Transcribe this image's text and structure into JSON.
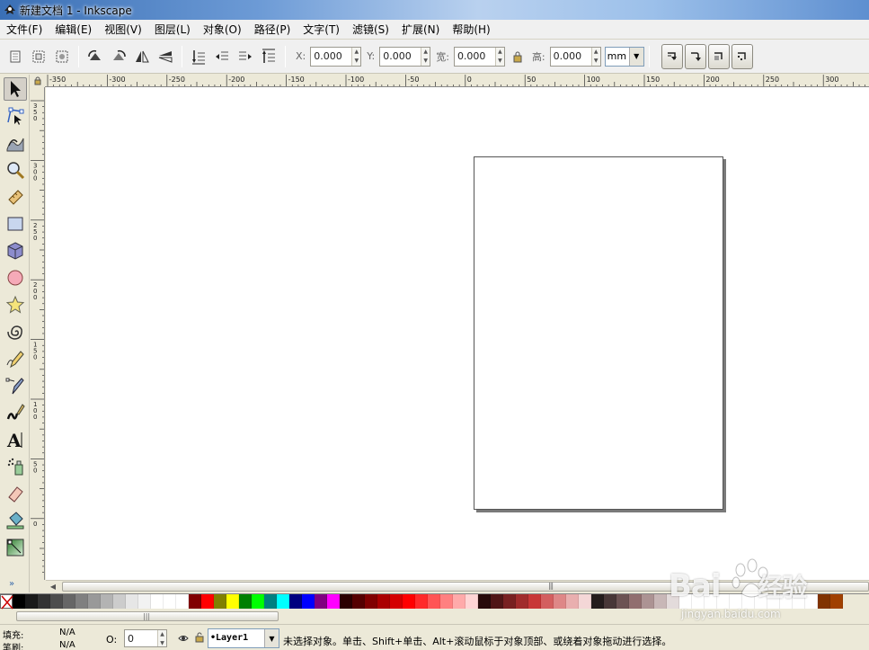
{
  "window": {
    "title": "新建文档 1 - Inkscape"
  },
  "menu": [
    "文件(F)",
    "编辑(E)",
    "视图(V)",
    "图层(L)",
    "对象(O)",
    "路径(P)",
    "文字(T)",
    "滤镜(S)",
    "扩展(N)",
    "帮助(H)"
  ],
  "toolbar": {
    "x_label": "X:",
    "x_value": "0.000",
    "y_label": "Y:",
    "y_value": "0.000",
    "w_label": "宽:",
    "w_value": "0.000",
    "h_label": "高:",
    "h_value": "0.000",
    "unit": "mm",
    "icons": [
      "select-all-icon",
      "select-all-layers-icon",
      "deselect-icon",
      "rotate-ccw-icon",
      "rotate-cw-icon",
      "flip-horizontal-icon",
      "flip-vertical-icon",
      "lower-to-bottom-icon",
      "lower-icon",
      "raise-icon",
      "raise-to-top-icon"
    ],
    "snap_icons": [
      "scale-stroke-icon",
      "scale-corners-icon",
      "transform-gradients-icon",
      "transform-patterns-icon"
    ]
  },
  "tools": [
    "selector",
    "node",
    "tweak",
    "zoom",
    "measure",
    "rectangle",
    "3d-box",
    "ellipse",
    "star",
    "spiral",
    "pencil",
    "pen",
    "calligraphy",
    "text",
    "spray",
    "eraser",
    "paint-bucket",
    "gradient"
  ],
  "toolbox_more": "»",
  "rulers": {
    "horizontal_ticks": [
      "-350",
      "-300",
      "-250",
      "-200",
      "-150",
      "-100",
      "-50",
      "0",
      "50",
      "100",
      "150",
      "200",
      "250",
      "300"
    ],
    "vertical_ticks": [
      "350",
      "300",
      "250",
      "200",
      "150",
      "100",
      "50",
      "0"
    ]
  },
  "palette": [
    "#000000",
    "#1a1a1a",
    "#333333",
    "#4d4d4d",
    "#666666",
    "#808080",
    "#999999",
    "#b3b3b3",
    "#cccccc",
    "#e6e6e6",
    "#f2f2f2",
    "#ffffff",
    "#ffffff",
    "#ffffff",
    "#800000",
    "#ff0000",
    "#808000",
    "#ffff00",
    "#008000",
    "#00ff00",
    "#008080",
    "#00ffff",
    "#000080",
    "#0000ff",
    "#800080",
    "#ff00ff",
    "#2b0000",
    "#550000",
    "#800000",
    "#aa0000",
    "#d40000",
    "#ff0000",
    "#ff2a2a",
    "#ff5555",
    "#ff8080",
    "#ffaaaa",
    "#ffd5d5",
    "#280b0b",
    "#501616",
    "#782121",
    "#a02c2c",
    "#c83737",
    "#d35f5f",
    "#de8787",
    "#e9afaf",
    "#f4d7d7",
    "#241c1c",
    "#483737",
    "#6c5353",
    "#916f6f",
    "#ac9393",
    "#c8b7b7",
    "#e3dbdb",
    "#ffffff",
    "#ffffff",
    "#ffffff",
    "#ffffff",
    "#ffffff",
    "#ffffff",
    "#ffffff",
    "#ffffff",
    "#ffffff",
    "#ffffff",
    "#ffffff",
    "#803300",
    "#a04000"
  ],
  "statusbar": {
    "fill_label": "填充:",
    "fill_value": "N/A",
    "stroke_label": "笔刷:",
    "stroke_value": "N/A",
    "opacity_label": "O:",
    "opacity_value": "0",
    "layer": "•Layer1",
    "message": "未选择对象。单击、Shift+单击、Alt+滚动鼠标于对象顶部、或绕着对象拖动进行选择。"
  },
  "watermark": {
    "brand": "Bai",
    "brand_cn": "经验",
    "url": "jingyan.baidu.com"
  }
}
